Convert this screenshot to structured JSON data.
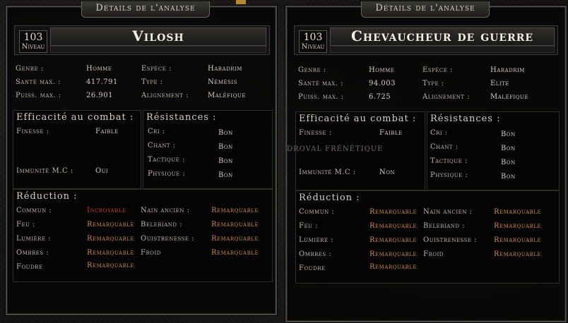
{
  "left": {
    "title": "Détails de l'analyse",
    "level": "103",
    "level_label": "Niveau",
    "name": "Vilosh",
    "stats": {
      "genre_label": "Genre :",
      "genre": "Homme",
      "espece_label": "Espèce :",
      "espece": "Haradrim",
      "sante_label": "Santé max. :",
      "sante": "417.791",
      "type_label": "Type :",
      "type": "Némésis",
      "puiss_label": "Puiss. max. :",
      "puiss": "26.901",
      "align_label": "Alignement :",
      "align": "Maléfique"
    },
    "combat": {
      "title": "Efficacité au combat :",
      "finesse_label": "Finesse :",
      "finesse": "Faible",
      "immunite_label": "Immunité M.C :",
      "immunite": "Oui"
    },
    "resist": {
      "title": "Résistances :",
      "cri_label": "Cri :",
      "cri": "Bon",
      "chant_label": "Chant :",
      "chant": "Bon",
      "tactique_label": "Tactique :",
      "tactique": "Bon",
      "physique_label": "Physique :",
      "physique": "Bon"
    },
    "reduction": {
      "title": "Réduction :",
      "commun_label": "Commun :",
      "commun": "Incroyable",
      "feu_label": "Feu :",
      "feu": "Remarquable",
      "lumiere_label": "Lumière :",
      "lumiere": "Remarquable",
      "ombres_label": "Ombres :",
      "ombres": "Remarquable",
      "foudre_label": "Foudre",
      "foudre": "Remarquable",
      "nain_label": "Nain ancien :",
      "nain": "Remarquable",
      "beleriand_label": "Beleriand :",
      "beleriand": "Remarquable",
      "ouist_label": "Ouistrenesse :",
      "ouist": "Remarquable",
      "froid_label": "Froid",
      "froid": "Remarquable"
    }
  },
  "right": {
    "title": "Détails de l'analyse",
    "level": "103",
    "level_label": "Niveau",
    "name": "Chevaucheur de guerre",
    "stats": {
      "genre_label": "Genre :",
      "genre": "Homme",
      "espece_label": "Espèce :",
      "espece": "Haradrim",
      "sante_label": "Santé max. :",
      "sante": "94.003",
      "type_label": "Type :",
      "type": "Elite",
      "puiss_label": "Puiss. max. :",
      "puiss": "6.725",
      "align_label": "Alignement :",
      "align": "Maléfique"
    },
    "combat": {
      "title": "Efficacité au combat :",
      "finesse_label": "Finesse :",
      "finesse": "Faible",
      "immunite_label": "Immunité M.C :",
      "immunite": "Non"
    },
    "resist": {
      "title": "Résistances :",
      "cri_label": "Cri :",
      "cri": "Bon",
      "chant_label": "Chant :",
      "chant": "Bon",
      "tactique_label": "Tactique :",
      "tactique": "Bon",
      "physique_label": "Physique :",
      "physique": "Bon"
    },
    "reduction": {
      "title": "Réduction :",
      "commun_label": "Commun :",
      "commun": "Remarquable",
      "feu_label": "Feu :",
      "feu": "Remarquable",
      "lumiere_label": "Lumière :",
      "lumiere": "Remarquable",
      "ombres_label": "Ombres :",
      "ombres": "Remarquable",
      "foudre_label": "Foudre",
      "foudre": "Remarquable",
      "nain_label": "Nain ancien :",
      "nain": "Remarquable",
      "beleriand_label": "Beleriand :",
      "beleriand": "Remarquable",
      "ouist_label": "Ouistrenesse :",
      "ouist": "Remarquable",
      "froid_label": "Froid",
      "froid": "Remarquable"
    }
  },
  "background_text": "DROVAL FRÉNÉTIQUE",
  "colors": {
    "remarquable": "#d2883a",
    "incroyable": "#cc3a2a"
  }
}
